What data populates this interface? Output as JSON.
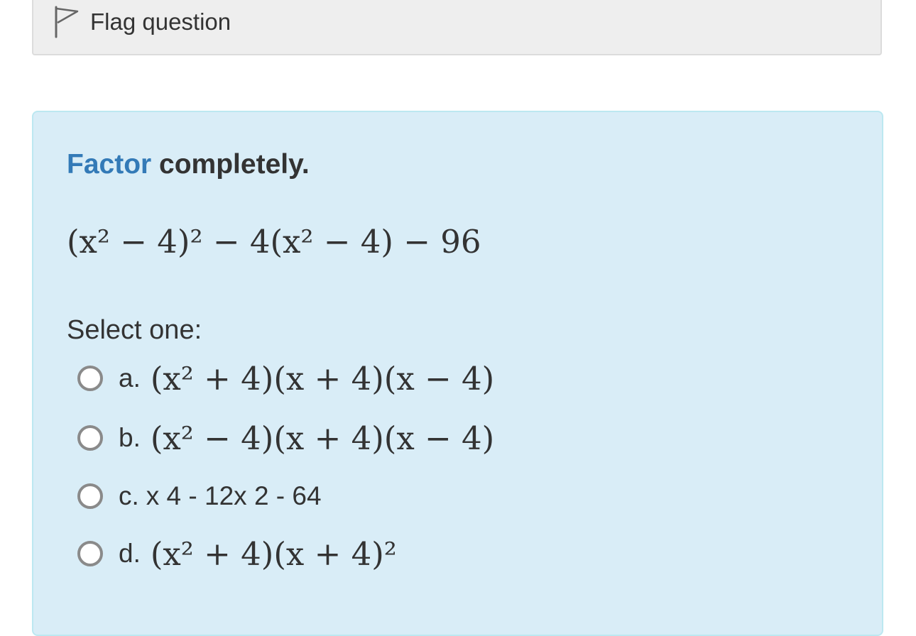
{
  "flag": {
    "label": "Flag question",
    "icon": "flag-outline-icon"
  },
  "question": {
    "prompt_keyword": "Factor",
    "prompt_rest": "completely.",
    "expression": "(x² − 4)² − 4(x² − 4) − 96",
    "select_label": "Select one:",
    "options": [
      {
        "letter": "a.",
        "text": "(x² + 4)(x + 4)(x − 4)"
      },
      {
        "letter": "b.",
        "text": "(x² − 4)(x + 4)(x − 4)"
      },
      {
        "letter": "c.",
        "text": "x 4 - 12x 2 - 64"
      },
      {
        "letter": "d.",
        "text": "(x² + 4)(x + 4)²"
      }
    ]
  },
  "colors": {
    "keyword": "#337ab7",
    "panel_bg": "#d9edf7",
    "panel_border": "#bce8f1",
    "flag_bar_bg": "#eeeeee"
  }
}
